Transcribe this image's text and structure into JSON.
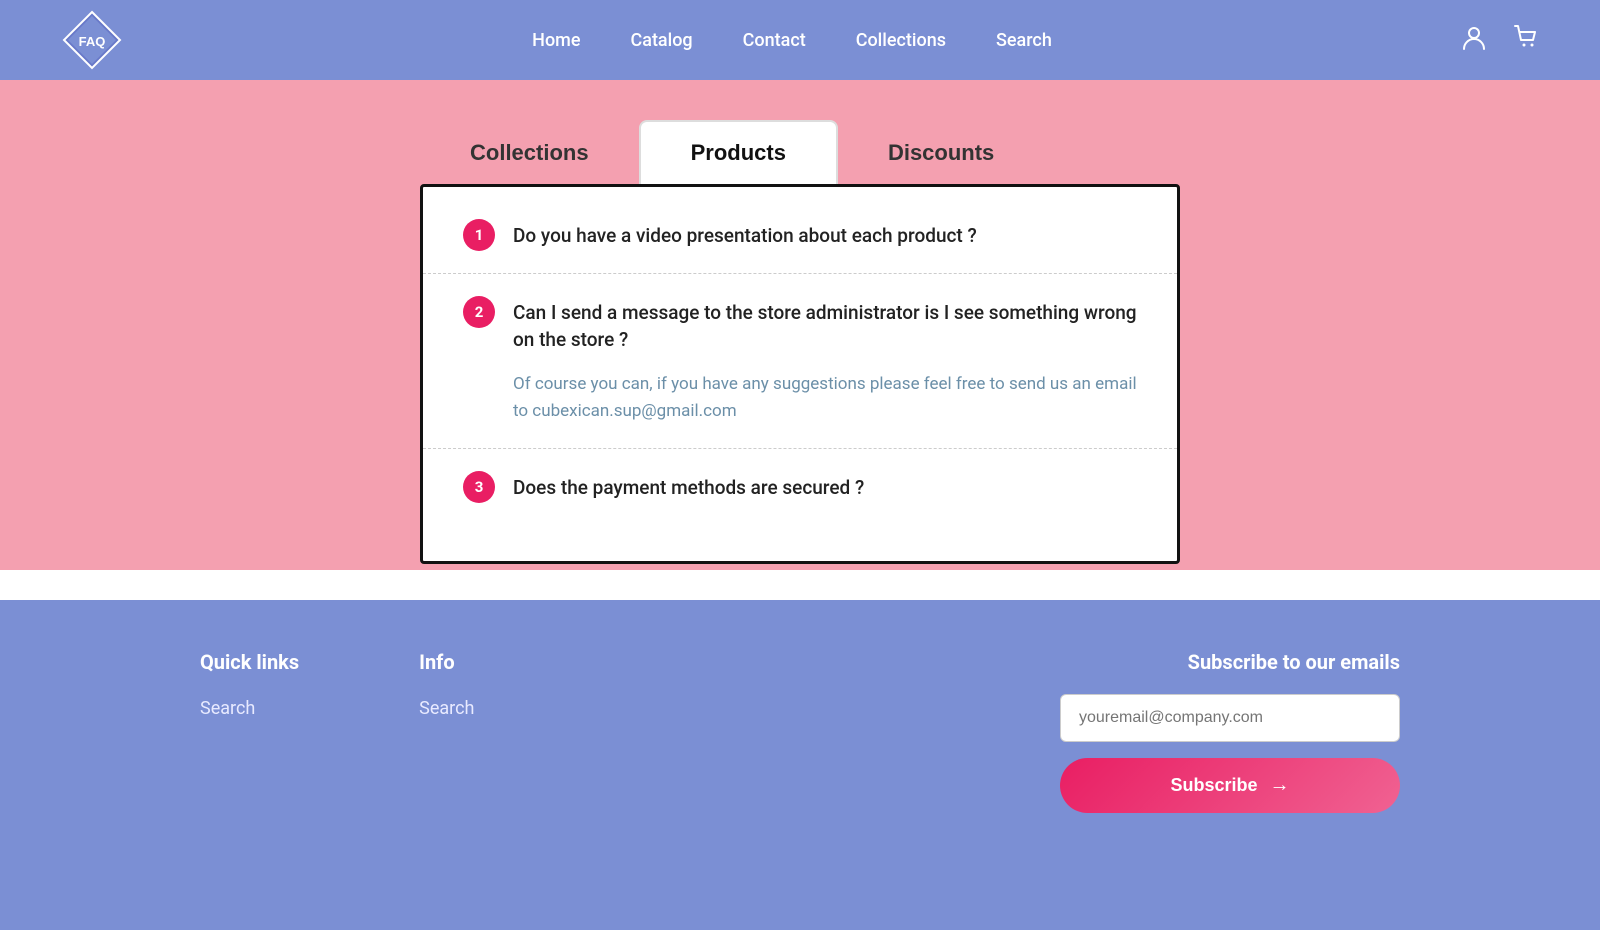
{
  "header": {
    "logo_text": "FAQ",
    "nav": {
      "items": [
        {
          "label": "Home",
          "id": "home"
        },
        {
          "label": "Catalog",
          "id": "catalog"
        },
        {
          "label": "Contact",
          "id": "contact"
        },
        {
          "label": "Collections",
          "id": "collections"
        },
        {
          "label": "Search",
          "id": "search"
        }
      ]
    }
  },
  "tabs": [
    {
      "label": "Collections",
      "id": "collections",
      "active": false
    },
    {
      "label": "Products",
      "id": "products",
      "active": true
    },
    {
      "label": "Discounts",
      "id": "discounts",
      "active": false
    }
  ],
  "faq": {
    "items": [
      {
        "number": "1",
        "question": "Do you have a video presentation about each product ?",
        "answer": null,
        "expanded": false
      },
      {
        "number": "2",
        "question": "Can I send a message to the store administrator is I see something wrong on the store ?",
        "answer": "Of course you can, if you have any suggestions please feel free to send us an email to cubexican.sup@gmail.com",
        "expanded": true
      },
      {
        "number": "3",
        "question": "Does the payment methods are secured ?",
        "answer": null,
        "expanded": false
      }
    ]
  },
  "footer": {
    "quick_links": {
      "title": "Quick links",
      "items": [
        {
          "label": "Search"
        }
      ]
    },
    "info": {
      "title": "Info",
      "items": [
        {
          "label": "Search"
        }
      ]
    },
    "subscribe": {
      "title": "Subscribe to our emails",
      "email_placeholder": "youremail@company.com",
      "button_label": "Subscribe"
    }
  }
}
